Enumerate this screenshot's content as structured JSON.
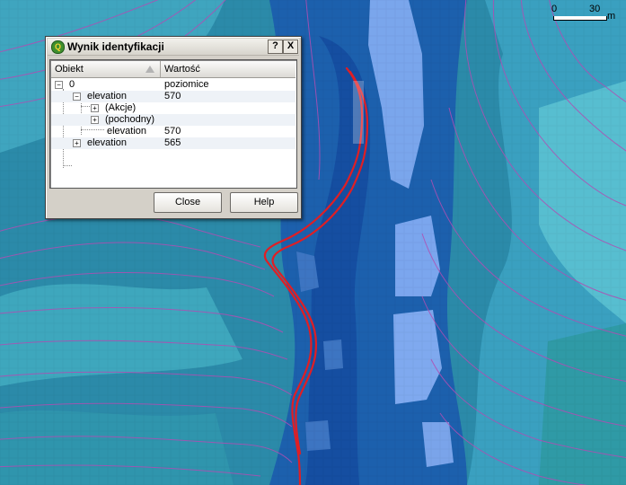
{
  "dialog": {
    "title": "Wynik identyfikacji",
    "help_glyph": "?",
    "close_glyph": "X",
    "app_icon_letter": "Q",
    "columns": {
      "object": "Obiekt",
      "value": "Wartość"
    },
    "rows": [
      {
        "label": "0",
        "value": "poziomice"
      },
      {
        "label": "elevation",
        "value": "570"
      },
      {
        "label": "(Akcje)",
        "value": ""
      },
      {
        "label": "(pochodny)",
        "value": ""
      },
      {
        "label": "elevation",
        "value": "570"
      },
      {
        "label": "elevation",
        "value": "565"
      }
    ],
    "buttons": {
      "close": "Close",
      "help": "Help"
    }
  },
  "scalebar": {
    "label_start": "0",
    "label_end": "30",
    "unit": "m"
  },
  "colors": {
    "slope_light": "#4fb6c7",
    "slope_mid": "#2a86a8",
    "valley_dark": "#1a5ca8",
    "valley_deep": "#13489a",
    "terrace": "#7fa9ef",
    "contour": "#b04eb3",
    "selected_feature": "#e01e24"
  }
}
